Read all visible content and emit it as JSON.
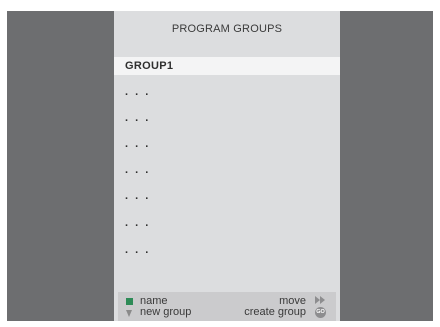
{
  "menu": {
    "title": "PROGRAM GROUPS",
    "groups": [
      "GROUP1",
      ". . .",
      ". . .",
      ". . .",
      ". . .",
      ". . .",
      ". . .",
      ". . ."
    ],
    "selected_index": 0
  },
  "footer": {
    "name_label": "name",
    "new_group_label": "new group",
    "move_label": "move",
    "create_group_label": "create group",
    "go_label": "GO",
    "green_button_icon": "green-square-icon",
    "down_icon": "down-triangle-icon",
    "fast_forward_icon": "fast-forward-icon",
    "go_icon": "go-icon"
  },
  "colors": {
    "background": "#6d6e70",
    "panel": "#dcdddf",
    "selected_row": "#f4f4f5",
    "footer": "#cbcbcd",
    "green_button": "#2e8b57"
  }
}
